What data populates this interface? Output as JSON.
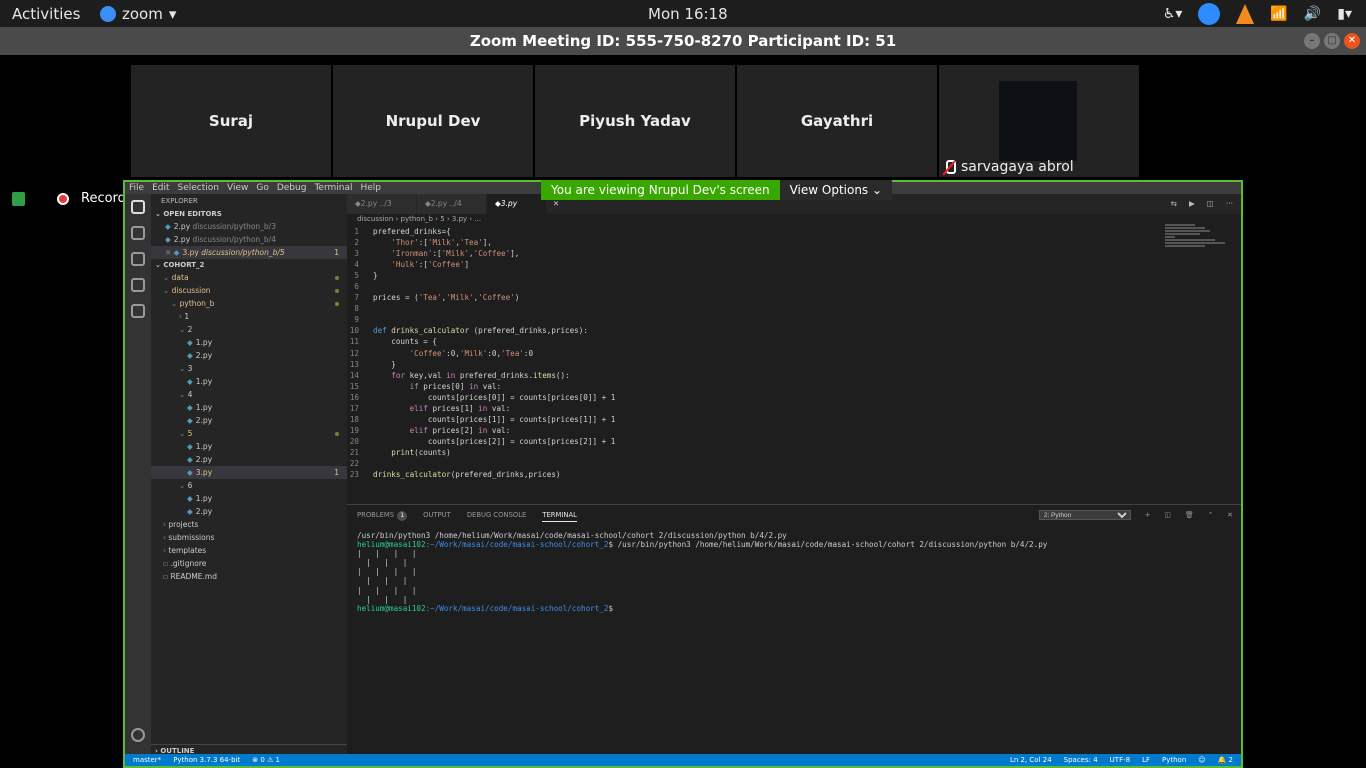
{
  "topbar": {
    "activities": "Activities",
    "app": "zoom",
    "clock": "Mon 16:18"
  },
  "window": {
    "title": "Zoom Meeting ID: 555-750-8270 Participant ID: 51"
  },
  "participants": [
    "Suraj",
    "Nrupul Dev",
    "Piyush Yadav",
    "Gayathri"
  ],
  "video_participant": "sarvagaya abrol",
  "recording": "Recording",
  "share": {
    "message": "You are viewing Nrupul Dev's screen",
    "options": "View Options"
  },
  "vscode": {
    "menu": [
      "File",
      "Edit",
      "Selection",
      "View",
      "Go",
      "Debug",
      "Terminal",
      "Help"
    ],
    "explorer_title": "EXPLORER",
    "open_editors_title": "OPEN EDITORS",
    "open_editors": [
      {
        "name": "2.py",
        "path": "discussion/python_b/3"
      },
      {
        "name": "2.py",
        "path": "discussion/python_b/4"
      },
      {
        "name": "3.py",
        "path": "discussion/python_b/5",
        "count": "1"
      }
    ],
    "project": "COHORT_2",
    "tree": [
      {
        "label": "data",
        "indent": 1,
        "type": "folder",
        "dot": true
      },
      {
        "label": "discussion",
        "indent": 1,
        "type": "folder",
        "dot": true
      },
      {
        "label": "python_b",
        "indent": 2,
        "type": "folder",
        "dot": true
      },
      {
        "label": "1",
        "indent": 3,
        "type": "dir"
      },
      {
        "label": "2",
        "indent": 3,
        "type": "dir"
      },
      {
        "label": "1.py",
        "indent": 4,
        "type": "py"
      },
      {
        "label": "2.py",
        "indent": 4,
        "type": "py"
      },
      {
        "label": "3",
        "indent": 3,
        "type": "dir"
      },
      {
        "label": "1.py",
        "indent": 4,
        "type": "py"
      },
      {
        "label": "4",
        "indent": 3,
        "type": "dir"
      },
      {
        "label": "1.py",
        "indent": 4,
        "type": "py"
      },
      {
        "label": "2.py",
        "indent": 4,
        "type": "py"
      },
      {
        "label": "5",
        "indent": 3,
        "type": "folder",
        "dot": true
      },
      {
        "label": "1.py",
        "indent": 4,
        "type": "py"
      },
      {
        "label": "2.py",
        "indent": 4,
        "type": "py"
      },
      {
        "label": "3.py",
        "indent": 4,
        "type": "pymod",
        "count": "1",
        "selected": true
      },
      {
        "label": "6",
        "indent": 3,
        "type": "dir"
      },
      {
        "label": "1.py",
        "indent": 4,
        "type": "py"
      },
      {
        "label": "2.py",
        "indent": 4,
        "type": "py"
      },
      {
        "label": "projects",
        "indent": 1,
        "type": "dir"
      },
      {
        "label": "submissions",
        "indent": 1,
        "type": "dir"
      },
      {
        "label": "templates",
        "indent": 1,
        "type": "dir"
      },
      {
        "label": ".gitignore",
        "indent": 1,
        "type": "file"
      },
      {
        "label": "README.md",
        "indent": 1,
        "type": "file"
      }
    ],
    "outline": "OUTLINE",
    "tabs": [
      {
        "name": "2.py",
        "hint": "../3"
      },
      {
        "name": "2.py",
        "hint": "../4"
      },
      {
        "name": "3.py",
        "hint": ""
      }
    ],
    "breadcrumb": "discussion › python_b › 5 › 3.py › ...",
    "code": [
      "prefered_drinks={",
      "    'Thor':['Milk','Tea'],",
      "    'Ironman':['Milk','Coffee'],",
      "    'Hulk':['Coffee']",
      "}",
      "",
      "prices = ('Tea','Milk','Coffee')",
      "",
      "",
      "def drinks_calculator (prefered_drinks,prices):",
      "    counts = {",
      "        'Coffee':0,'Milk':0,'Tea':0",
      "    }",
      "    for key,val in prefered_drinks.items():",
      "        if prices[0] in val:",
      "            counts[prices[0]] = counts[prices[0]] + 1",
      "        elif prices[1] in val:",
      "            counts[prices[1]] = counts[prices[1]] + 1",
      "        elif prices[2] in val:",
      "            counts[prices[2]] = counts[prices[2]] + 1",
      "    print(counts)",
      "",
      "drinks_calculator(prefered_drinks,prices)"
    ],
    "panel_tabs": [
      "PROBLEMS",
      "OUTPUT",
      "DEBUG CONSOLE",
      "TERMINAL"
    ],
    "problems_count": "1",
    "terminal_select": "2: Python",
    "terminal": [
      {
        "text": "/usr/bin/python3 /home/helium/Work/masai/code/masai-school/cohort 2/discussion/python b/4/2.py"
      },
      {
        "prompt": "helium@masai102",
        "path": ":~/Work/masai/code/masai-school/cohort_2",
        "text": "$ /usr/bin/python3 /home/helium/Work/masai/code/masai-school/cohort 2/discussion/python b/4/2.py"
      },
      {
        "text": "|   |   |   |"
      },
      {
        "text": "  |   |   |"
      },
      {
        "text": "|   |   |   |"
      },
      {
        "text": "  |   |   |"
      },
      {
        "text": "|   |   |   |"
      },
      {
        "text": "  |   |   |"
      },
      {
        "prompt": "helium@masai102",
        "path": ":~/Work/masai/code/masai-school/cohort_2",
        "text": "$"
      }
    ],
    "status_left": [
      "master*",
      "Python 3.7.3 64-bit",
      "⊗ 0 ⚠ 1"
    ],
    "status_right": [
      "Ln 2, Col 24",
      "Spaces: 4",
      "UTF-8",
      "LF",
      "Python",
      "☺",
      "🔔 2"
    ]
  }
}
